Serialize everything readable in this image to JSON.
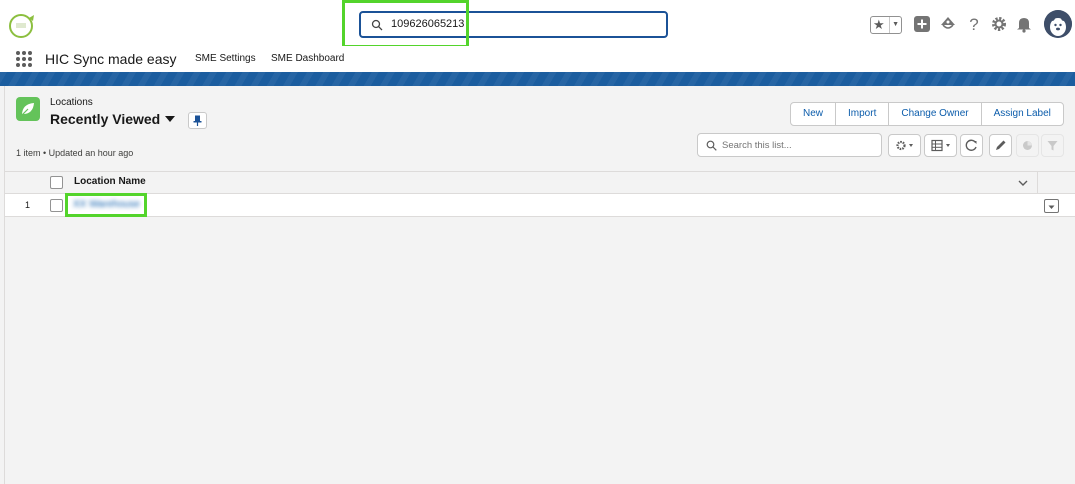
{
  "global_header": {
    "search_value": "109626065213",
    "icons": [
      "app-logo",
      "search-icon",
      "favorites-star-icon",
      "favorites-dropdown-icon",
      "global-add-icon",
      "trailhead-icon",
      "help-icon",
      "setup-gear-icon",
      "notifications-bell-icon",
      "user-avatar"
    ]
  },
  "app_nav": {
    "app_name": "HIC Sync made easy",
    "items": [
      {
        "label": "SME Settings"
      },
      {
        "label": "SME Dashboard"
      }
    ]
  },
  "list_view": {
    "object_label": "Locations",
    "title": "Recently Viewed",
    "meta": "1 item • Updated an hour ago",
    "buttons": [
      "New",
      "Import",
      "Change Owner",
      "Assign Label"
    ],
    "search_placeholder": "Search this list...",
    "columns": [
      "Location Name"
    ],
    "rows": [
      {
        "num": "1",
        "name": "XX Warehouse"
      }
    ]
  },
  "colors": {
    "brand_blue": "#1b5d9f",
    "link": "#0b5cab",
    "object_icon": "#64c35a",
    "highlight": "#53d42b"
  }
}
